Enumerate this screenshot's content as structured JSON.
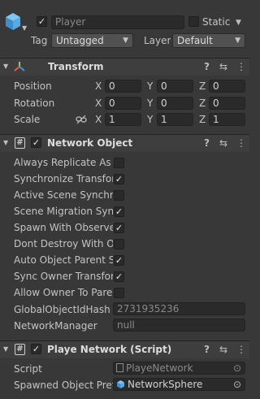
{
  "object_header": {
    "name": "Player",
    "active_checked": true,
    "static_label": "Static",
    "static_checked": false,
    "tag_label": "Tag",
    "tag_value": "Untagged",
    "layer_label": "Layer",
    "layer_value": "Default"
  },
  "transform": {
    "title": "Transform",
    "rows": [
      {
        "label": "Position",
        "x": "0",
        "y": "0",
        "z": "0"
      },
      {
        "label": "Rotation",
        "x": "0",
        "y": "0",
        "z": "0"
      },
      {
        "label": "Scale",
        "x": "1",
        "y": "1",
        "z": "1"
      }
    ],
    "axis_x": "X",
    "axis_y": "Y",
    "axis_z": "Z"
  },
  "network_object": {
    "title": "Network Object",
    "enabled": true,
    "props": [
      {
        "label": "Always Replicate As R",
        "checked": false
      },
      {
        "label": "Synchronize Transfor",
        "checked": true
      },
      {
        "label": "Active Scene Synchro",
        "checked": false
      },
      {
        "label": "Scene Migration Sync",
        "checked": true
      },
      {
        "label": "Spawn With Observer",
        "checked": true
      },
      {
        "label": "Dont Destroy With Ow",
        "checked": false
      },
      {
        "label": "Auto Object Parent S",
        "checked": true
      },
      {
        "label": "Sync Owner Transfor",
        "checked": true
      },
      {
        "label": "Allow Owner To Pare",
        "checked": false
      }
    ],
    "global_id_label": "GlobalObjectIdHash",
    "global_id_value": "2731935236",
    "network_manager_label": "NetworkManager",
    "network_manager_value": "null"
  },
  "playe_network": {
    "title": "Playe Network (Script)",
    "enabled": true,
    "script_label": "Script",
    "script_value": "PlayeNetwork",
    "spawned_label": "Spawned Object Pref",
    "spawned_value": "NetworkSphere"
  },
  "icons": {
    "help": "?",
    "settings": "⇆",
    "more": "⋮",
    "collapse": "▼",
    "target": "⊙",
    "check": "✓"
  }
}
